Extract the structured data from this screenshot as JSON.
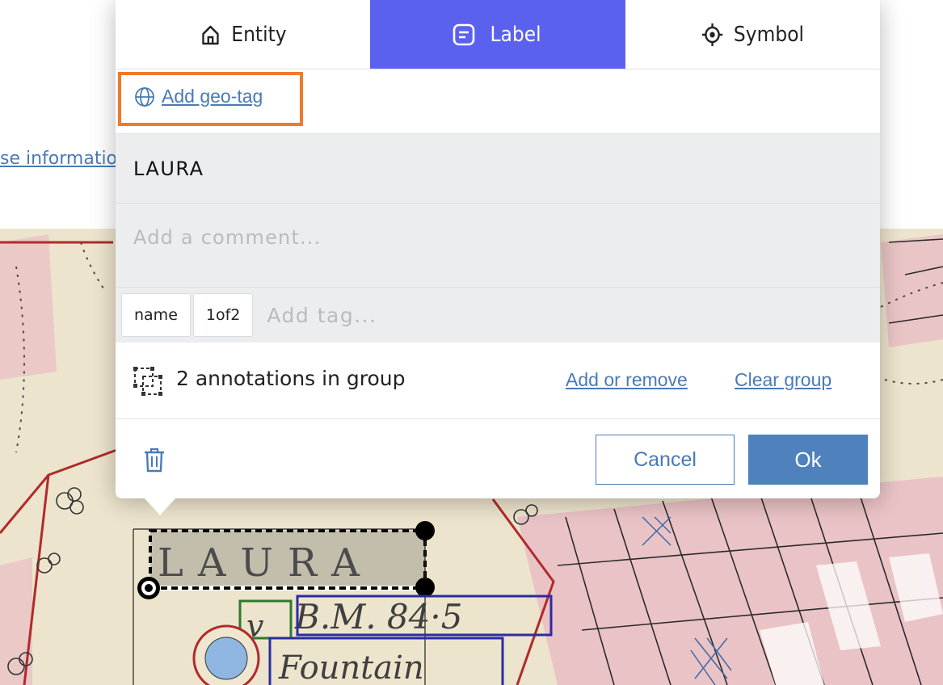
{
  "background": {
    "link_text": "se informatio"
  },
  "tabs": [
    {
      "label": "Entity",
      "icon": "home-icon",
      "active": false
    },
    {
      "label": "Label",
      "icon": "label-icon",
      "active": true
    },
    {
      "label": "Symbol",
      "icon": "crosshair-icon",
      "active": false
    }
  ],
  "geo_tag": {
    "label": "Add geo-tag",
    "icon": "globe-icon"
  },
  "body_text": "LAURA",
  "comment": {
    "placeholder": "Add a comment..."
  },
  "tags": {
    "items": [
      "name",
      "1of2"
    ],
    "placeholder": "Add tag..."
  },
  "group": {
    "label": "2 annotations in group",
    "add_remove": "Add or remove",
    "clear": "Clear group"
  },
  "footer": {
    "cancel": "Cancel",
    "ok": "Ok"
  },
  "map": {
    "labels": [
      "LAURA",
      "B.M. 84·5",
      "Fountain"
    ],
    "colors": {
      "paper": "#ece4cc",
      "parcel": "#eabdc4",
      "accent": "#5b61ef",
      "highlight": "#ee7a2b",
      "link": "#4a7ab6"
    }
  }
}
